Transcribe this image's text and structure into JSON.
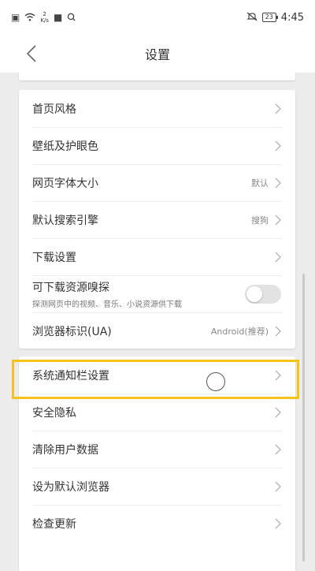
{
  "status_bar": {
    "net_speed_value": "2",
    "net_speed_unit": "K/s",
    "battery": "23",
    "time": "4:45"
  },
  "header": {
    "title": "设置"
  },
  "group1": [
    {
      "label": "首页风格",
      "value": ""
    },
    {
      "label": "壁纸及护眼色",
      "value": ""
    },
    {
      "label": "网页字体大小",
      "value": "默认"
    },
    {
      "label": "默认搜索引擎",
      "value": "搜狗"
    },
    {
      "label": "下载设置",
      "value": ""
    },
    {
      "label": "可下载资源嗅探",
      "subtitle": "探测网页中的视频、音乐、小说资源供下载",
      "toggle_on": false
    },
    {
      "label": "浏览器标识(UA)",
      "value": "Android(推荐)"
    }
  ],
  "group2": [
    {
      "label": "系统通知栏设置"
    },
    {
      "label": "安全隐私"
    },
    {
      "label": "清除用户数据"
    },
    {
      "label": "设为默认浏览器"
    },
    {
      "label": "检查更新"
    }
  ],
  "colors": {
    "highlight": "#f5c31c",
    "background": "#ececec"
  }
}
